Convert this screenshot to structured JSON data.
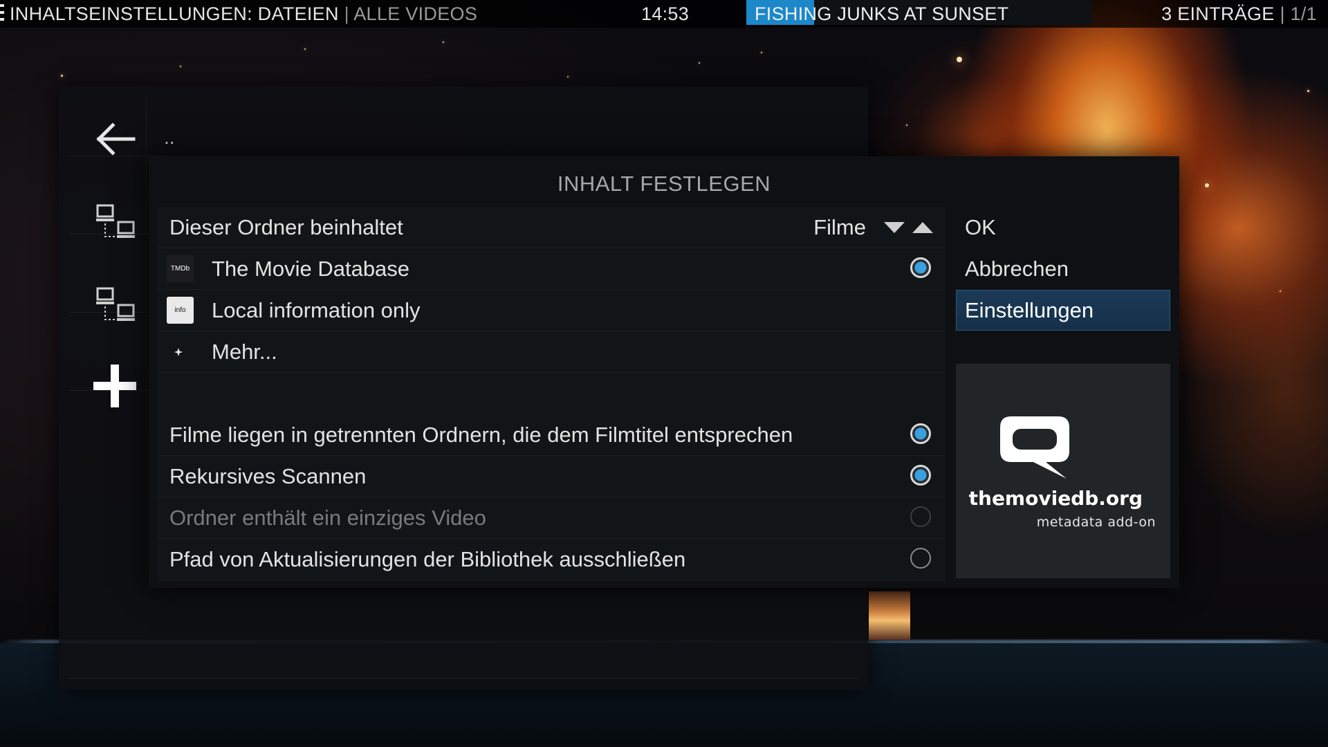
{
  "header": {
    "title": "Inhaltseinstellungen: Dateien",
    "separator": "|",
    "subtitle": "Alle Videos",
    "clock": "14:53",
    "now_playing": "Fishing junks at sunset",
    "item_count": "3 Einträge",
    "pages": "| 1/1"
  },
  "browser": {
    "parent_item": "..",
    "icons": [
      "back-arrow-icon",
      "network-icon",
      "network-icon",
      "add-icon"
    ]
  },
  "dialog": {
    "title": "Inhalt festlegen",
    "content_row": {
      "label": "Dieser Ordner beinhaltet",
      "value": "Filme"
    },
    "scrapers": [
      {
        "label": "The Movie Database",
        "icon": "tmdb-icon",
        "icon_text": "TMDb",
        "selected": true
      },
      {
        "label": "Local information only",
        "icon": "info-icon",
        "icon_text": "info",
        "selected": false
      },
      {
        "label": "Mehr...",
        "icon": "more-icon",
        "selected": false
      }
    ],
    "options": [
      {
        "label": "Filme liegen in getrennten Ordnern, die dem Filmtitel entsprechen",
        "checked": true,
        "enabled": true
      },
      {
        "label": "Rekursives Scannen",
        "checked": true,
        "enabled": true
      },
      {
        "label": "Ordner enthält ein einziges Video",
        "checked": false,
        "enabled": false
      },
      {
        "label": "Pfad von Aktualisierungen der Bibliothek ausschließen",
        "checked": false,
        "enabled": true
      }
    ],
    "buttons": {
      "ok": "OK",
      "cancel": "Abbrechen",
      "settings": "Einstellungen"
    },
    "addon_preview": {
      "site": "themoviedb.org",
      "tagline": "metadata add-on"
    }
  },
  "colors": {
    "accent": "#1c87c9",
    "focus": "#1c3a57",
    "radio_on": "#39a0e0"
  },
  "now_playing_progress": 0.196
}
